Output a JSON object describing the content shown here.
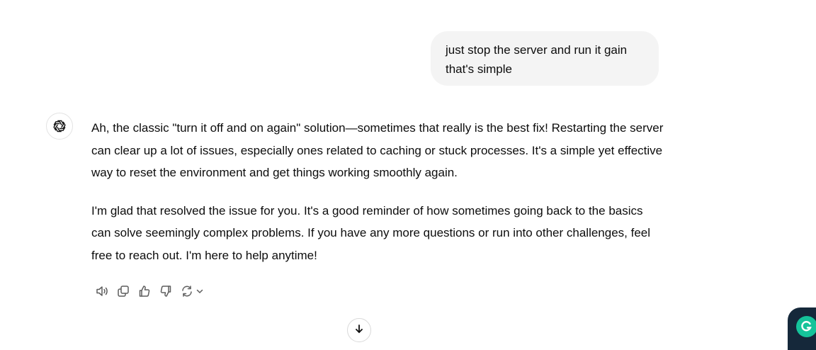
{
  "user_message": {
    "lines": [
      "just stop the server and run it gain",
      "that's simple"
    ]
  },
  "assistant_message": {
    "avatar_icon": "openai-logo-icon",
    "paragraphs": [
      "Ah, the classic \"turn it off and on again\" solution—sometimes that really is the best fix! Restarting the server can clear up a lot of issues, especially ones related to caching or stuck processes. It's a simple yet effective way to reset the environment and get things working smoothly again.",
      "I'm glad that resolved the issue for you. It's a good reminder of how sometimes going back to the basics can solve seemingly complex problems. If you have any more questions or run into other challenges, feel free to reach out. I'm here to help anytime!"
    ]
  },
  "message_actions": [
    {
      "icon": "read-aloud-icon"
    },
    {
      "icon": "copy-icon"
    },
    {
      "icon": "thumbs-up-icon"
    },
    {
      "icon": "thumbs-down-icon"
    },
    {
      "icon": "regenerate-icon"
    }
  ],
  "widgets": {
    "scroll_down_icon": "arrow-down-icon",
    "grammarly_icon": "grammarly-icon",
    "grammarly_color": "#15c39a"
  }
}
